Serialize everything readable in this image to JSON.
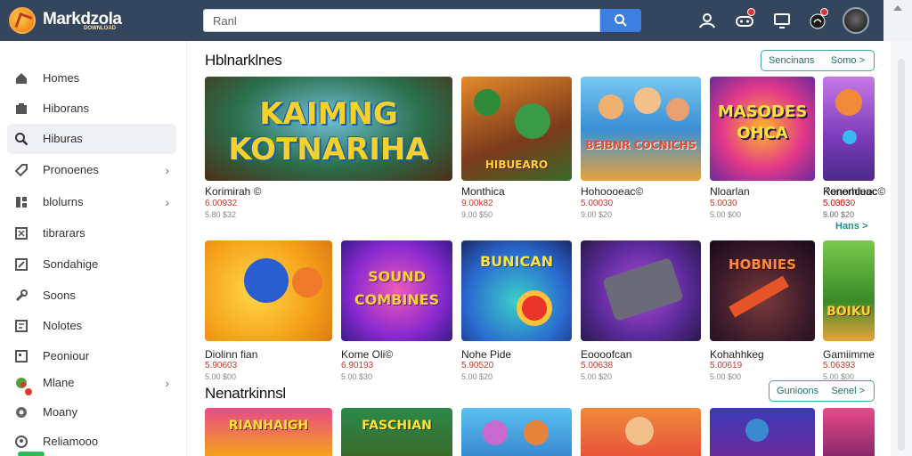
{
  "app": {
    "brand": "Markdzola",
    "brand_sub": "DOWNLOAD"
  },
  "search": {
    "value": "Ranl"
  },
  "sidebar": {
    "items": [
      {
        "label": "Homes",
        "icon": "home-icon",
        "chevron": false
      },
      {
        "label": "Hiborans",
        "icon": "library-icon",
        "chevron": false
      },
      {
        "label": "Hiburas",
        "icon": "search-icon",
        "chevron": false,
        "active": true
      },
      {
        "label": "Pronoenes",
        "icon": "tag-icon",
        "chevron": true
      },
      {
        "label": "blolurns",
        "icon": "grid-icon",
        "chevron": true
      },
      {
        "label": "tibrarars",
        "icon": "checkbox-icon",
        "chevron": false
      },
      {
        "label": "Sondahige",
        "icon": "edit-icon",
        "chevron": false
      },
      {
        "label": "Soons",
        "icon": "wrench-icon",
        "chevron": false
      },
      {
        "label": "Nolotes",
        "icon": "note-icon",
        "chevron": false
      },
      {
        "label": "Peoniour",
        "icon": "page-icon",
        "chevron": false
      },
      {
        "label": "Mlane",
        "icon": "game-icon",
        "chevron": true,
        "badge": true
      },
      {
        "label": "Moany",
        "icon": "settings-icon",
        "chevron": false
      },
      {
        "label": "Reliamooo",
        "icon": "profile-icon",
        "chevron": false
      }
    ]
  },
  "section1": {
    "title": "Hblnarklnes",
    "btn_left": "Sencinans",
    "btn_right": "Somo >",
    "more": "Hans >"
  },
  "section2": {
    "title": "Nenatrkinnsl",
    "btn_left": "Gunioons",
    "btn_right": "Senel >"
  },
  "row1": [
    {
      "art": "KAIMNG KOTNARIHA",
      "title": "Korimirah ©",
      "price": "6.00932",
      "sub": "5.80 $32"
    },
    {
      "art": "HIBUEARO",
      "title": "Monthica",
      "price": "9.00k82",
      "sub": "9.00 $50"
    },
    {
      "art": "",
      "title": "Hohoooeac©",
      "price": "5.00030",
      "sub": "9.00 $20"
    },
    {
      "art": "BEIBNR COCNICHS",
      "title": "Nloarlan",
      "price": "5.0030",
      "sub": "5.00 $00"
    },
    {
      "art": "MASODES OHCA",
      "title": "Konerhiuac",
      "price": "5.00530",
      "sub": "5.90 $20"
    },
    {
      "art": "",
      "title": "Renondeoc©",
      "price": "5.0303",
      "sub": "9.00 $20"
    }
  ],
  "row2": [
    {
      "art": "",
      "title": "Diolinn fian",
      "price": "5.90603",
      "sub": "5.00 $00"
    },
    {
      "art": "SOUND COMBINES",
      "title": "Kome Oli©",
      "price": "6.90193",
      "sub": "5.00 $30"
    },
    {
      "art": "BUNICAN",
      "title": "Nohe Pide",
      "price": "5.90520",
      "sub": "5.00 $20"
    },
    {
      "art": "",
      "title": "Eoooofcan",
      "price": "5.00638",
      "sub": "5.00 $20"
    },
    {
      "art": "HOBNIES",
      "title": "Kohahhkeg",
      "price": "5.00619",
      "sub": "5.00 $00"
    },
    {
      "art": "BOIKU",
      "title": "Gamiimme",
      "price": "5.06393",
      "sub": "5.00 $00"
    }
  ],
  "row3": [
    {
      "art": "RIANHAIGH"
    },
    {
      "art": "FASCHIAN"
    },
    {
      "art": ""
    },
    {
      "art": ""
    },
    {
      "art": ""
    },
    {
      "art": ""
    }
  ]
}
